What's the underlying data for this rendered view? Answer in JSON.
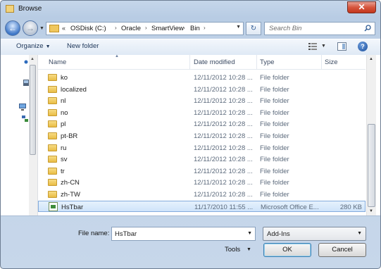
{
  "window": {
    "title": "Browse",
    "close_glyph": "✕"
  },
  "nav": {
    "back_glyph": "←",
    "forward_glyph": "→",
    "breadcrumb_chevron": "«",
    "path": [
      "OSDisk (C:)",
      "Oracle",
      "SmartView",
      "Bin"
    ],
    "refresh_glyph": "↻",
    "search_placeholder": "Search Bin"
  },
  "toolbar": {
    "organize_label": "Organize",
    "new_folder_label": "New folder",
    "help_glyph": "?"
  },
  "columns": {
    "name": "Name",
    "date": "Date modified",
    "type": "Type",
    "size": "Size"
  },
  "rows": [
    {
      "name": "ko",
      "date": "12/11/2012 10:28 ...",
      "type": "File folder",
      "size": "",
      "kind": "folder"
    },
    {
      "name": "localized",
      "date": "12/11/2012 10:28 ...",
      "type": "File folder",
      "size": "",
      "kind": "folder"
    },
    {
      "name": "nl",
      "date": "12/11/2012 10:28 ...",
      "type": "File folder",
      "size": "",
      "kind": "folder"
    },
    {
      "name": "no",
      "date": "12/11/2012 10:28 ...",
      "type": "File folder",
      "size": "",
      "kind": "folder"
    },
    {
      "name": "pl",
      "date": "12/11/2012 10:28 ...",
      "type": "File folder",
      "size": "",
      "kind": "folder"
    },
    {
      "name": "pt-BR",
      "date": "12/11/2012 10:28 ...",
      "type": "File folder",
      "size": "",
      "kind": "folder"
    },
    {
      "name": "ru",
      "date": "12/11/2012 10:28 ...",
      "type": "File folder",
      "size": "",
      "kind": "folder"
    },
    {
      "name": "sv",
      "date": "12/11/2012 10:28 ...",
      "type": "File folder",
      "size": "",
      "kind": "folder"
    },
    {
      "name": "tr",
      "date": "12/11/2012 10:28 ...",
      "type": "File folder",
      "size": "",
      "kind": "folder"
    },
    {
      "name": "zh-CN",
      "date": "12/11/2012 10:28 ...",
      "type": "File folder",
      "size": "",
      "kind": "folder"
    },
    {
      "name": "zh-TW",
      "date": "12/11/2012 10:28 ...",
      "type": "File folder",
      "size": "",
      "kind": "folder"
    },
    {
      "name": "HsTbar",
      "date": "11/17/2010 11:55 ...",
      "type": "Microsoft Office E...",
      "size": "280 KB",
      "kind": "file",
      "selected": true
    }
  ],
  "footer": {
    "file_name_label": "File name:",
    "file_name_value": "HsTbar",
    "filter_value": "Add-Ins",
    "tools_label": "Tools",
    "ok_label": "OK",
    "cancel_label": "Cancel"
  }
}
